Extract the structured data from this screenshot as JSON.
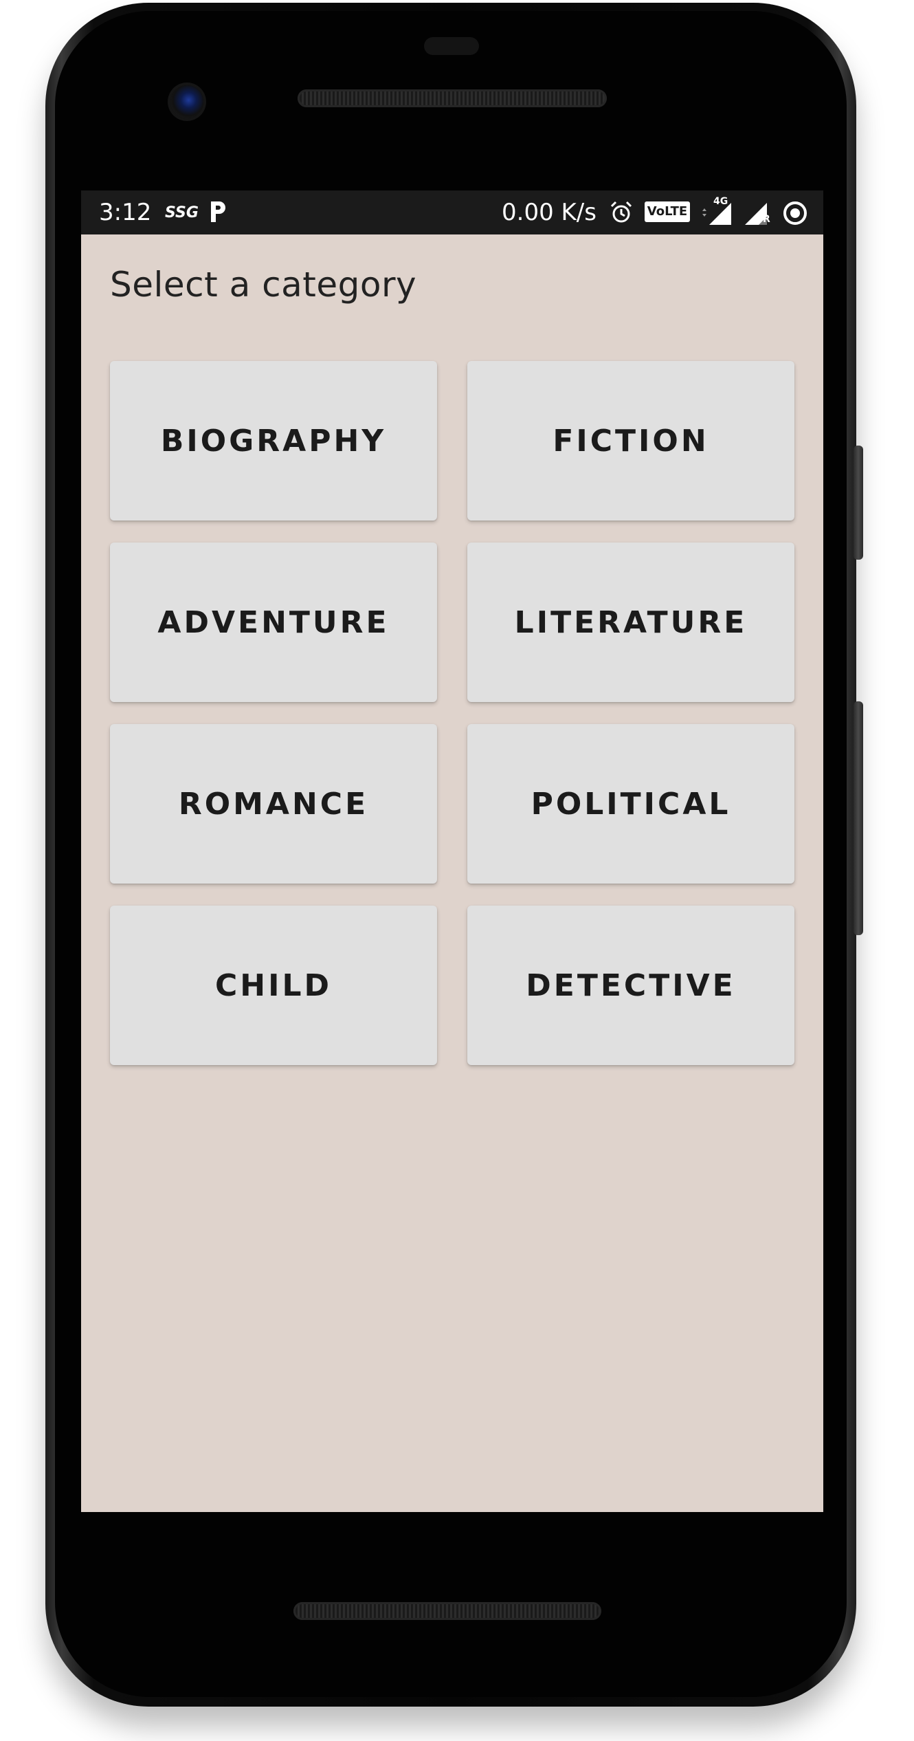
{
  "status_bar": {
    "time": "3:12",
    "carrier_badge": "SSG",
    "app_badge_icon": "p-icon",
    "network_speed": "0.00 K/s",
    "alarm_icon": "alarm-icon",
    "volte_label": "VoLTE",
    "network_type": "4G",
    "roaming_indicator": "R",
    "signal_icon": "signal-icon",
    "record_icon": "record-icon"
  },
  "main": {
    "title": "Select a category",
    "categories": [
      {
        "label": "BIOGRAPHY"
      },
      {
        "label": "FICTION"
      },
      {
        "label": "ADVENTURE"
      },
      {
        "label": "LITERATURE"
      },
      {
        "label": "ROMANCE"
      },
      {
        "label": "POLITICAL"
      },
      {
        "label": "CHILD"
      },
      {
        "label": "DETECTIVE"
      }
    ]
  },
  "colors": {
    "screen_background": "#dfd3cc",
    "card_background": "#e0e0e0",
    "card_text": "#1b1b1b",
    "status_bar": "#1b1b1b"
  }
}
